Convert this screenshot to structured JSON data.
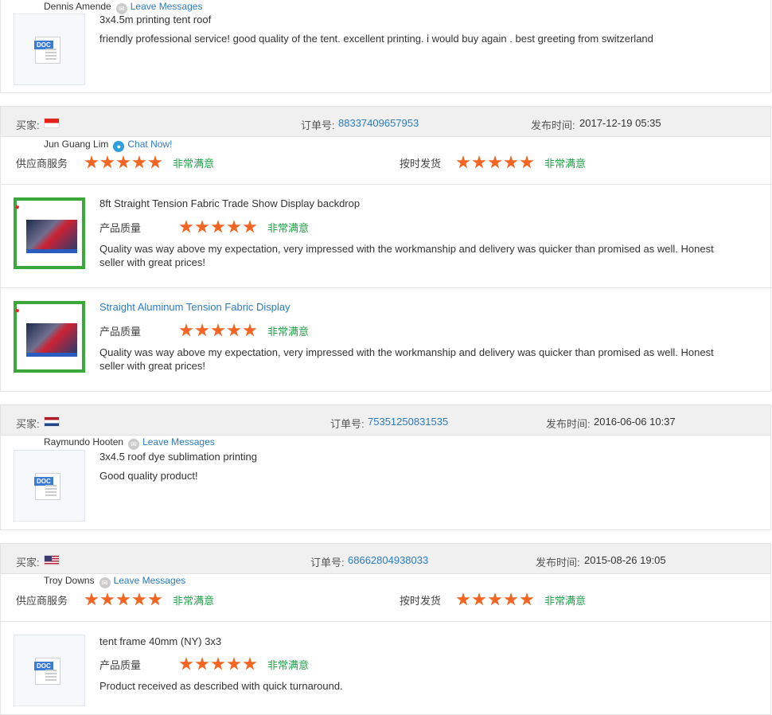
{
  "review1": {
    "buyer": "Dennis Amende",
    "action": "Leave Messages",
    "product": "3x4.5m printing tent roof",
    "text": "friendly professional service! good quality of the tent. excellent printing. i would buy again . best greeting from switzerland"
  },
  "labels": {
    "buyer": "买家:",
    "order": "订单号:",
    "posted": "发布时间:",
    "supplier_service": "供应商服务",
    "on_time": "按时发货",
    "quality": "产品质量",
    "very_satisfied": "非常满意",
    "doc_tag": "DOC"
  },
  "review2": {
    "order_no": "88337409657953",
    "date": "2017-12-19 05:35",
    "buyer": "Jun Guang Lim",
    "action": "Chat Now!",
    "supplier_rating": 5,
    "shipping_rating": 5,
    "products": [
      {
        "title": "8ft Straight Tension Fabric Trade Show Display backdrop",
        "rating": 5,
        "text": "Quality was way above my expectation, very impressed with the workmanship and delivery was quicker than promised as well. Honest seller with great prices!"
      },
      {
        "title": "Straight Aluminum Tension Fabric Display",
        "rating": 5,
        "text": "Quality was way above my expectation, very impressed with the workmanship and delivery was quicker than promised as well. Honest seller with great prices!"
      }
    ]
  },
  "review3": {
    "order_no": "75351250831535",
    "date": "2016-06-06 10:37",
    "buyer": "Raymundo Hooten",
    "action": "Leave Messages",
    "product": "3x4.5 roof dye sublimation printing",
    "text": "Good quality product!"
  },
  "review4": {
    "order_no": "68662804938033",
    "date": "2015-08-26 19:05",
    "buyer": "Troy Downs",
    "action": "Leave Messages",
    "supplier_rating": 5,
    "shipping_rating": 5,
    "product": "tent frame 40mm (NY) 3x3",
    "rating": 5,
    "text": "Product received as described with quick turnaround."
  },
  "colors": {
    "star": "#f26522",
    "link": "#2d7bbf",
    "satisfied": "#22a34a"
  }
}
